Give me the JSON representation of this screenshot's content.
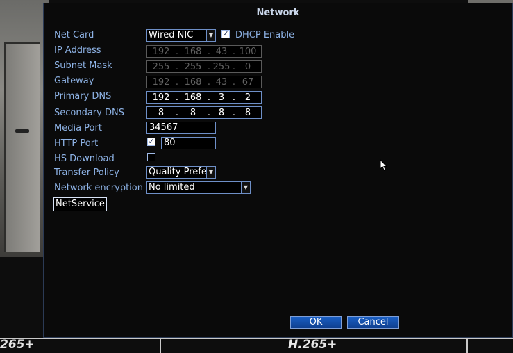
{
  "dialog": {
    "title": "Network",
    "fields": {
      "net_card": {
        "label": "Net Card",
        "value": "Wired NIC"
      },
      "dhcp": {
        "label": "DHCP Enable",
        "checked": true
      },
      "ip_address": {
        "label": "IP Address",
        "octets": [
          "192",
          "168",
          "43",
          "100"
        ]
      },
      "subnet_mask": {
        "label": "Subnet Mask",
        "octets": [
          "255",
          "255",
          "255",
          "0"
        ]
      },
      "gateway": {
        "label": "Gateway",
        "octets": [
          "192",
          "168",
          "43",
          "67"
        ]
      },
      "primary_dns": {
        "label": "Primary DNS",
        "octets": [
          "192",
          "168",
          "3",
          "2"
        ]
      },
      "secondary_dns": {
        "label": "Secondary DNS",
        "octets": [
          "8",
          "8",
          "8",
          "8"
        ]
      },
      "media_port": {
        "label": "Media Port",
        "value": "34567"
      },
      "http_port": {
        "label": "HTTP Port",
        "value": "80",
        "checked": true
      },
      "hs_download": {
        "label": "HS Download",
        "checked": false
      },
      "transfer_policy": {
        "label": "Transfer Policy",
        "value": "Quality Prefe"
      },
      "network_encryption": {
        "label": "Network encryption",
        "value": "No limited"
      }
    },
    "netservice_label": "NetService",
    "ok_label": "OK",
    "cancel_label": "Cancel"
  },
  "background": {
    "codec_left": "265+",
    "codec_center": "H.265+"
  },
  "icons": {
    "checkmark": "✓",
    "dropdown": "▼"
  }
}
